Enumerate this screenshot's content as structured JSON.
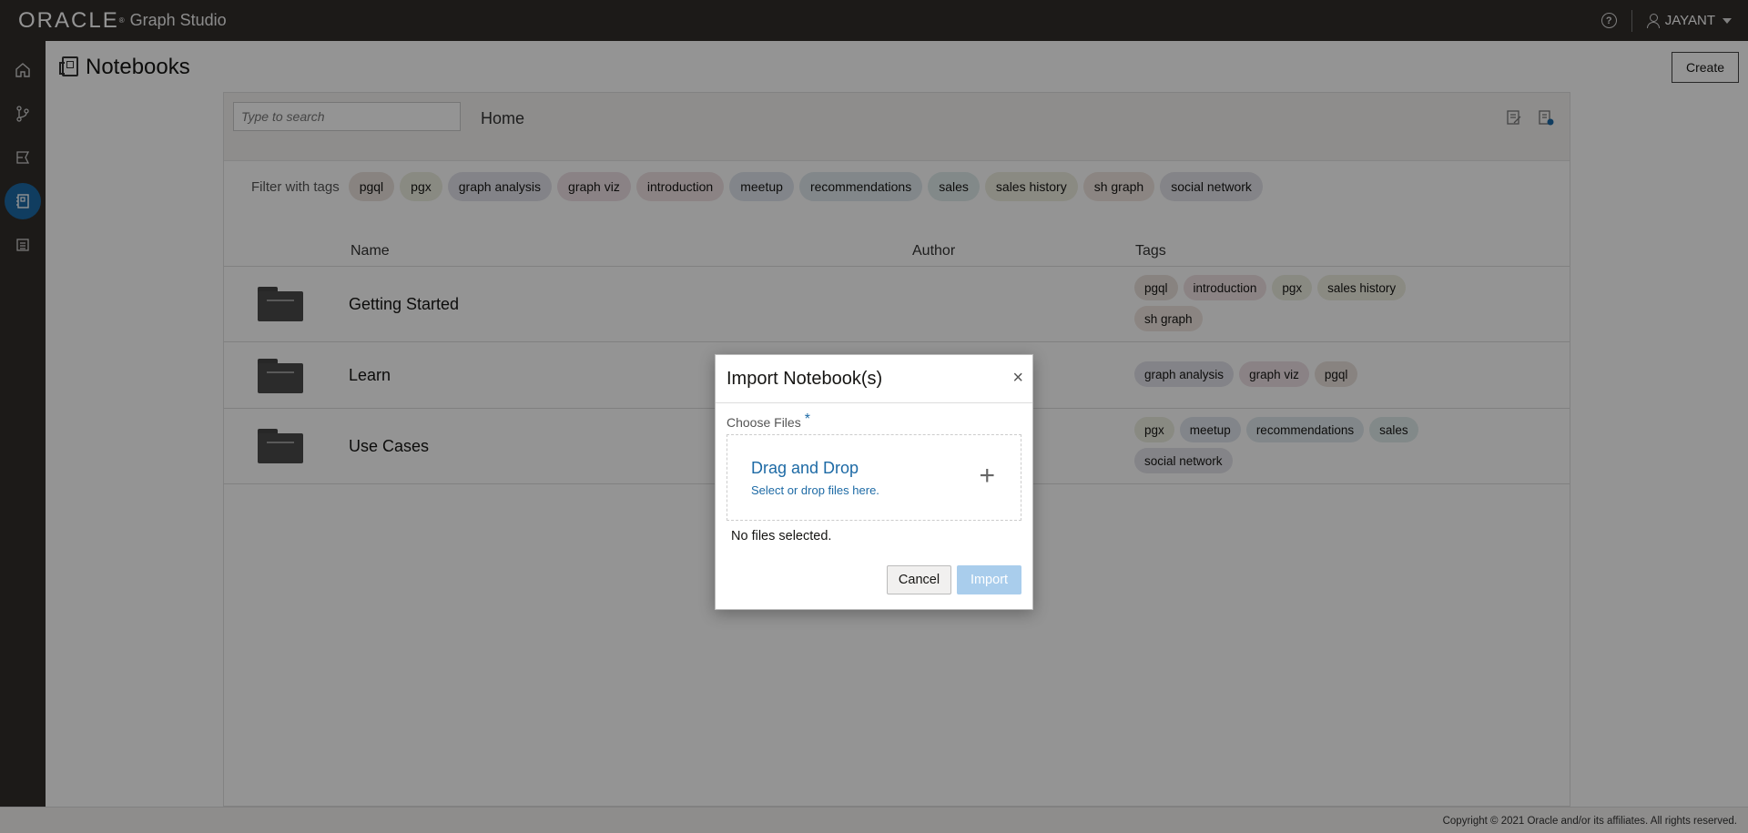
{
  "app": {
    "brand": "ORACLE",
    "product": "Graph Studio",
    "help_glyph": "?",
    "user": "JAYANT"
  },
  "sidebar": {
    "items": [
      {
        "icon": "home-icon"
      },
      {
        "icon": "graph-branch-icon"
      },
      {
        "icon": "jobs-icon"
      },
      {
        "icon": "notebook-icon",
        "active": true
      },
      {
        "icon": "list-icon"
      }
    ],
    "expand_glyph": "››"
  },
  "page": {
    "title": "Notebooks",
    "create_label": "Create"
  },
  "toolbar": {
    "search_placeholder": "Type to search",
    "breadcrumb": "Home"
  },
  "filter": {
    "label": "Filter with tags",
    "tags": [
      {
        "label": "pgql",
        "color": "#ebe2dd"
      },
      {
        "label": "pgx",
        "color": "#eceee0"
      },
      {
        "label": "graph analysis",
        "color": "#e2e2ea"
      },
      {
        "label": "graph viz",
        "color": "#eee0e6"
      },
      {
        "label": "introduction",
        "color": "#f0e2e4"
      },
      {
        "label": "meetup",
        "color": "#e0e6ee"
      },
      {
        "label": "recommendations",
        "color": "#e0e9ee"
      },
      {
        "label": "sales",
        "color": "#e0ecec"
      },
      {
        "label": "sales history",
        "color": "#eeeee0"
      },
      {
        "label": "sh graph",
        "color": "#f0e6e0"
      },
      {
        "label": "social network",
        "color": "#e3e3ea"
      }
    ]
  },
  "table": {
    "columns": [
      "Name",
      "Author",
      "Tags"
    ],
    "rows": [
      {
        "name": "Getting Started",
        "author": "",
        "tags": [
          "pgql",
          "introduction",
          "pgx",
          "sales history",
          "sh graph"
        ]
      },
      {
        "name": "Learn",
        "author": "",
        "tags": [
          "graph analysis",
          "graph viz",
          "pgql"
        ]
      },
      {
        "name": "Use Cases",
        "author": "",
        "tags": [
          "pgx",
          "meetup",
          "recommendations",
          "sales",
          "social network"
        ]
      }
    ]
  },
  "footer": {
    "copyright": "Copyright © 2021 Oracle and/or its affiliates. All rights reserved."
  },
  "dialog": {
    "title": "Import Notebook(s)",
    "close_glyph": "×",
    "choose_label": "Choose Files",
    "required_mark": "*",
    "dropzone_title": "Drag and Drop",
    "dropzone_sub": "Select or drop files here.",
    "plus_glyph": "+",
    "no_files": "No files selected.",
    "cancel_label": "Cancel",
    "import_label": "Import"
  }
}
